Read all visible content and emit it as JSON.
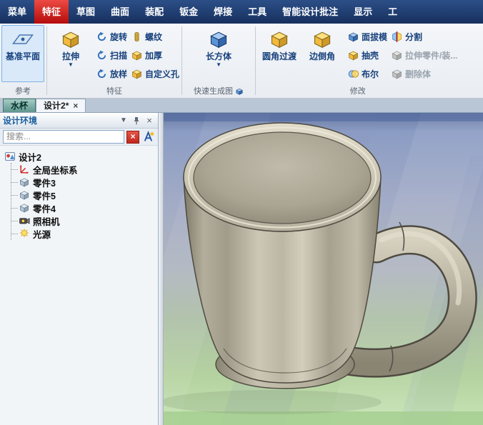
{
  "glyphs": {
    "dropdown": "▼",
    "close": "×"
  },
  "menubar": {
    "items": [
      "菜单",
      "特征",
      "草图",
      "曲面",
      "装配",
      "钣金",
      "焊接",
      "工具",
      "智能设计批注",
      "显示",
      "工"
    ]
  },
  "ribbon": {
    "reference": {
      "label": "参考",
      "datum_plane": "基准平面"
    },
    "features": {
      "label": "特征",
      "extrude": "拉伸",
      "revolve": "旋转",
      "sweep": "扫描",
      "loft": "放样",
      "thread": "螺纹",
      "thicken": "加厚",
      "custom_hole": "自定义孔"
    },
    "quick": {
      "label": "快速生成图",
      "cuboid": "长方体"
    },
    "modify": {
      "label": "修改",
      "fillet": "圆角过渡",
      "chamfer": "边倒角",
      "draft": "面拔模",
      "shell": "抽壳",
      "boolean": "布尔",
      "split": "分割",
      "stretch_part": "拉伸零件/装...",
      "delete_body": "删除体"
    }
  },
  "doc_tabs": {
    "tab1": "水杯",
    "tab2": "设计2*"
  },
  "panel": {
    "title": "设计环境",
    "search_placeholder": "搜索...",
    "tree": {
      "root": "设计2",
      "items": [
        "全局坐标系",
        "零件3",
        "零件5",
        "零件4",
        "照相机",
        "光源"
      ]
    }
  },
  "colors": {
    "menubar_blue": "#1d3c6e",
    "active_tab_red": "#c40f0f",
    "selection_blue": "#d9e9fa",
    "viewport_top": "#66799f",
    "viewport_bottom": "#c8e6b6",
    "mug_base": "#bcb7a4"
  }
}
